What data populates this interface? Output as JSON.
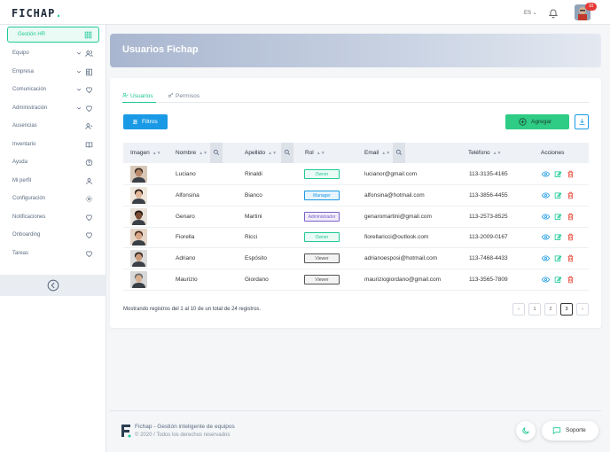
{
  "app": {
    "logo": "FICHAP",
    "logo_dot": "."
  },
  "topbar": {
    "language": "ES",
    "notifications_count": "10"
  },
  "sidebar": {
    "active": {
      "label": "Gestión HR",
      "icon": "grid-icon"
    },
    "items": [
      {
        "label": "Equipo",
        "chevron": true,
        "icon": "users-icon"
      },
      {
        "label": "Empresa",
        "chevron": true,
        "icon": "building-icon"
      },
      {
        "label": "Comunicación",
        "chevron": true,
        "icon": "heart-icon"
      },
      {
        "label": "Administración",
        "chevron": true,
        "icon": "heart-icon"
      },
      {
        "label": "Ausencias",
        "chevron": false,
        "icon": "user-minus-icon"
      },
      {
        "label": "Inventario",
        "chevron": false,
        "icon": "book-icon"
      },
      {
        "label": "Ayuda",
        "chevron": false,
        "icon": "help-icon"
      },
      {
        "label": "Mi perfil",
        "chevron": false,
        "icon": "user-icon"
      },
      {
        "label": "Configuración",
        "chevron": false,
        "icon": "gear-icon"
      },
      {
        "label": "Notificaciones",
        "chevron": false,
        "icon": "heart-icon"
      },
      {
        "label": "Onboarding",
        "chevron": false,
        "icon": "heart-icon"
      },
      {
        "label": "Tareas",
        "chevron": false,
        "icon": "heart-icon"
      }
    ]
  },
  "page": {
    "title": "Usuarios Fichap"
  },
  "tabs": [
    {
      "label": "Usuarios",
      "active": true
    },
    {
      "label": "Permisos",
      "active": false
    }
  ],
  "toolbar": {
    "filter_label": "Filtros",
    "add_label": "Agregar"
  },
  "table": {
    "headers": {
      "image": "Imagen",
      "name": "Nombre",
      "surname": "Apellido",
      "role": "Rol",
      "email": "Email",
      "phone": "Teléfono",
      "actions": "Acciones"
    },
    "rows": [
      {
        "name": "Luciano",
        "surname": "Rinaldi",
        "role": "Owner",
        "email": "lucianor@gmail.com",
        "phone": "113-3135-4165",
        "skin": "#b98a6a",
        "hair": "#3a2a20",
        "bg": "#d9c8b8"
      },
      {
        "name": "Alfonsina",
        "surname": "Bianco",
        "role": "Manager",
        "email": "alfonsina@hotmail.com",
        "phone": "113-3856-4455",
        "skin": "#e2b79a",
        "hair": "#2a1a14",
        "bg": "#efe6dc"
      },
      {
        "name": "Genaro",
        "surname": "Martini",
        "role": "Administrador",
        "email": "genaromartini@gmail.com",
        "phone": "113-2573-8525",
        "skin": "#7a4f34",
        "hair": "#1e140f",
        "bg": "#e8e2da"
      },
      {
        "name": "Fiorella",
        "surname": "Ricci",
        "role": "Owner",
        "email": "fiorellaricci@outlook.com",
        "phone": "113-2009-0167",
        "skin": "#d6a688",
        "hair": "#4a2c1c",
        "bg": "#e6d6c8"
      },
      {
        "name": "Adriano",
        "surname": "Espósito",
        "role": "Viewer",
        "email": "adrianoesposi@hotmail.com",
        "phone": "113-7468-4433",
        "skin": "#c99a7c",
        "hair": "#2e2420",
        "bg": "#dcdcdc"
      },
      {
        "name": "Maurizio",
        "surname": "Giordano",
        "role": "Viewer",
        "email": "mauriziogiordano@gmail.com",
        "phone": "113-3565-7809",
        "skin": "#d8b090",
        "hair": "#6a6a6a",
        "bg": "#d8d8d8"
      }
    ]
  },
  "role_colors": {
    "Owner": {
      "color": "#20c997",
      "bg": "#eafaf4"
    },
    "Manager": {
      "color": "#1a9ae6",
      "bg": "#e8f4fc"
    },
    "Administrador": {
      "color": "#7b61c9",
      "bg": "#f1edfb"
    },
    "Viewer": {
      "color": "#555",
      "bg": "#f3f3f3"
    }
  },
  "pagination": {
    "info": "Mostrando registros del 1 al 10 de un total de 24 registros.",
    "pages": [
      "1",
      "2",
      "3"
    ],
    "current": "3"
  },
  "footer": {
    "title": "Fichap - Gestión inteligente de equipos",
    "copyright": "© 2020 / Todos los derechos reservados",
    "support_label": "Soporte"
  }
}
